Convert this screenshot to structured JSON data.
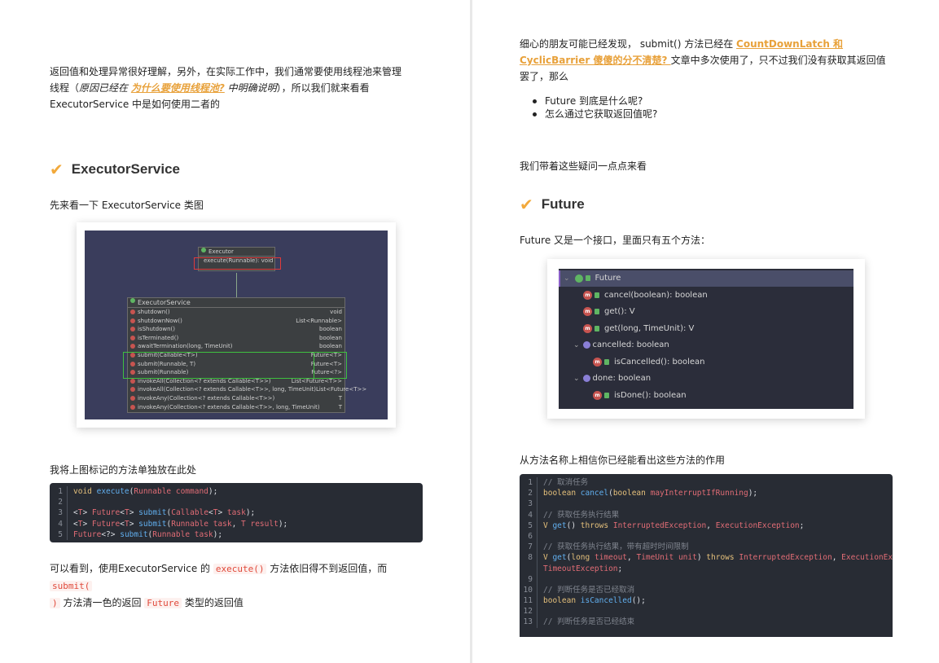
{
  "left": {
    "intro_1": "返回值和处理异常很好理解，另外，在实际工作中，我们通常要使用线程池来管理",
    "intro_2_pre": "线程（",
    "intro_2_italic": "原因已经在 ",
    "intro_2_link": "为什么要使用线程池?",
    "intro_2_italic2": " 中明确说明",
    "intro_2_post": "），所以我们就来看看",
    "intro_3": "ExecutorService 中是如何使用二者的",
    "heading": "ExecutorService",
    "diagram_caption": "先来看一下 ExecutorService 类图",
    "uml": {
      "executor_title": "Executor",
      "executor_method": "execute(Runnable): void",
      "service_title": "ExecutorService",
      "methods": [
        {
          "name": "shutdown()",
          "ret": "void"
        },
        {
          "name": "shutdownNow()",
          "ret": "List<Runnable>"
        },
        {
          "name": "isShutdown()",
          "ret": "boolean"
        },
        {
          "name": "isTerminated()",
          "ret": "boolean"
        },
        {
          "name": "awaitTermination(long, TimeUnit)",
          "ret": "boolean"
        },
        {
          "name": "submit(Callable<T>)",
          "ret": "Future<T>"
        },
        {
          "name": "submit(Runnable, T)",
          "ret": "Future<T>"
        },
        {
          "name": "submit(Runnable)",
          "ret": "Future<?>"
        },
        {
          "name": "invokeAll(Collection<? extends Callable<T>>)",
          "ret": "List<Future<T>>"
        },
        {
          "name": "invokeAll(Collection<? extends Callable<T>>, long, TimeUnit)",
          "ret": "List<Future<T>>"
        },
        {
          "name": "invokeAny(Collection<? extends Callable<T>>)",
          "ret": "T"
        },
        {
          "name": "invokeAny(Collection<? extends Callable<T>>, long, TimeUnit)",
          "ret": "T"
        }
      ]
    },
    "code_caption": "我将上图标记的方法单独放在此处",
    "code_lines": [
      {
        "n": "1",
        "tokens": [
          [
            "kw",
            "void "
          ],
          [
            "fn",
            "execute"
          ],
          [
            "pl",
            "("
          ],
          [
            "ty",
            "Runnable command"
          ],
          [
            "pl",
            ");"
          ]
        ]
      },
      {
        "n": "2",
        "tokens": []
      },
      {
        "n": "3",
        "tokens": [
          [
            "pl",
            "<"
          ],
          [
            "ty",
            "T"
          ],
          [
            "pl",
            "> "
          ],
          [
            "ty",
            "Future"
          ],
          [
            "pl",
            "<"
          ],
          [
            "ty",
            "T"
          ],
          [
            "pl",
            "> "
          ],
          [
            "fn",
            "submit"
          ],
          [
            "pl",
            "("
          ],
          [
            "ty",
            "Callable"
          ],
          [
            "pl",
            "<"
          ],
          [
            "ty",
            "T"
          ],
          [
            "pl",
            "> "
          ],
          [
            "ty",
            "task"
          ],
          [
            "pl",
            ");"
          ]
        ]
      },
      {
        "n": "4",
        "tokens": [
          [
            "pl",
            "<"
          ],
          [
            "ty",
            "T"
          ],
          [
            "pl",
            "> "
          ],
          [
            "ty",
            "Future"
          ],
          [
            "pl",
            "<"
          ],
          [
            "ty",
            "T"
          ],
          [
            "pl",
            "> "
          ],
          [
            "fn",
            "submit"
          ],
          [
            "pl",
            "("
          ],
          [
            "ty",
            "Runnable task"
          ],
          [
            "pl",
            ", "
          ],
          [
            "ty",
            "T result"
          ],
          [
            "pl",
            ");"
          ]
        ]
      },
      {
        "n": "5",
        "tokens": [
          [
            "ty",
            "Future"
          ],
          [
            "pl",
            "<?> "
          ],
          [
            "fn",
            "submit"
          ],
          [
            "pl",
            "("
          ],
          [
            "ty",
            "Runnable task"
          ],
          [
            "pl",
            ");"
          ]
        ]
      }
    ],
    "outro_1_pre": "可以看到，使用ExecutorService 的 ",
    "outro_1_code1": "execute()",
    "outro_1_mid": " 方法依旧得不到返回值，而 ",
    "outro_1_code2": "submit(",
    "outro_2_code": ")",
    "outro_2_mid": " 方法清一色的返回 ",
    "outro_2_code2": "Future",
    "outro_2_post": " 类型的返回值"
  },
  "right": {
    "intro_1_pre": "细心的朋友可能已经发现， submit() 方法已经在 ",
    "intro_1_link": "CountDownLatch 和",
    "intro_2_link": "CyclicBarrier 傻傻的分不清楚? ",
    "intro_2_post": " 文章中多次使用了，只不过我们没有获取其返回值",
    "intro_3": "罢了，那么",
    "bullets": [
      "Future 到底是什么呢?",
      "怎么通过它获取返回值呢?"
    ],
    "lead": "我们带着这些疑问一点点来看",
    "heading": "Future",
    "desc": "Future 又是一个接口，里面只有五个方法：",
    "tree": {
      "root": "Future",
      "items": [
        "cancel(boolean): boolean",
        "get(): V",
        "get(long, TimeUnit): V",
        "cancelled: boolean",
        "isCancelled(): boolean",
        "done: boolean",
        "isDone(): boolean"
      ]
    },
    "code_caption": "从方法名称上相信你已经能看出这些方法的作用",
    "code_lines": [
      {
        "n": "1",
        "tokens": [
          [
            "cm",
            "// 取消任务"
          ]
        ]
      },
      {
        "n": "2",
        "tokens": [
          [
            "kw",
            "boolean "
          ],
          [
            "fn",
            "cancel"
          ],
          [
            "pl",
            "("
          ],
          [
            "kw",
            "boolean "
          ],
          [
            "ty",
            "mayInterruptIfRunning"
          ],
          [
            "pl",
            ");"
          ]
        ]
      },
      {
        "n": "3",
        "tokens": []
      },
      {
        "n": "4",
        "tokens": [
          [
            "cm",
            "// 获取任务执行结果"
          ]
        ]
      },
      {
        "n": "5",
        "tokens": [
          [
            "kw",
            "V "
          ],
          [
            "fn",
            "get"
          ],
          [
            "pl",
            "() "
          ],
          [
            "kw",
            "throws "
          ],
          [
            "ty",
            "InterruptedException"
          ],
          [
            "pl",
            ", "
          ],
          [
            "ty",
            "ExecutionException"
          ],
          [
            "pl",
            ";"
          ]
        ]
      },
      {
        "n": "6",
        "tokens": []
      },
      {
        "n": "7",
        "tokens": [
          [
            "cm",
            "// 获取任务执行结果，带有超时时间限制"
          ]
        ]
      },
      {
        "n": "8",
        "tokens": [
          [
            "kw",
            "V "
          ],
          [
            "fn",
            "get"
          ],
          [
            "pl",
            "("
          ],
          [
            "kw",
            "long "
          ],
          [
            "ty",
            "timeout"
          ],
          [
            "pl",
            ", "
          ],
          [
            "ty",
            "TimeUnit unit"
          ],
          [
            "pl",
            ") "
          ],
          [
            "kw",
            "throws "
          ],
          [
            "ty",
            "InterruptedException"
          ],
          [
            "pl",
            ", "
          ],
          [
            "ty",
            "ExecutionException"
          ],
          [
            "pl",
            ","
          ]
        ]
      },
      {
        "n": "",
        "tokens": [
          [
            "pl",
            "  "
          ],
          [
            "ty",
            "TimeoutException"
          ],
          [
            "pl",
            ";"
          ]
        ]
      },
      {
        "n": "9",
        "tokens": []
      },
      {
        "n": "10",
        "tokens": [
          [
            "cm",
            "// 判断任务是否已经取消"
          ]
        ]
      },
      {
        "n": "11",
        "tokens": [
          [
            "kw",
            "boolean "
          ],
          [
            "fn",
            "isCancelled"
          ],
          [
            "pl",
            "();"
          ]
        ]
      },
      {
        "n": "12",
        "tokens": []
      },
      {
        "n": "13",
        "tokens": [
          [
            "cm",
            "// 判断任务是否已经结束"
          ]
        ]
      }
    ]
  },
  "colors": {
    "accent_orange": "#e8a13a",
    "code_bg": "#282c34",
    "red_box": "#e03a3a",
    "green_box": "#3fc03f"
  }
}
